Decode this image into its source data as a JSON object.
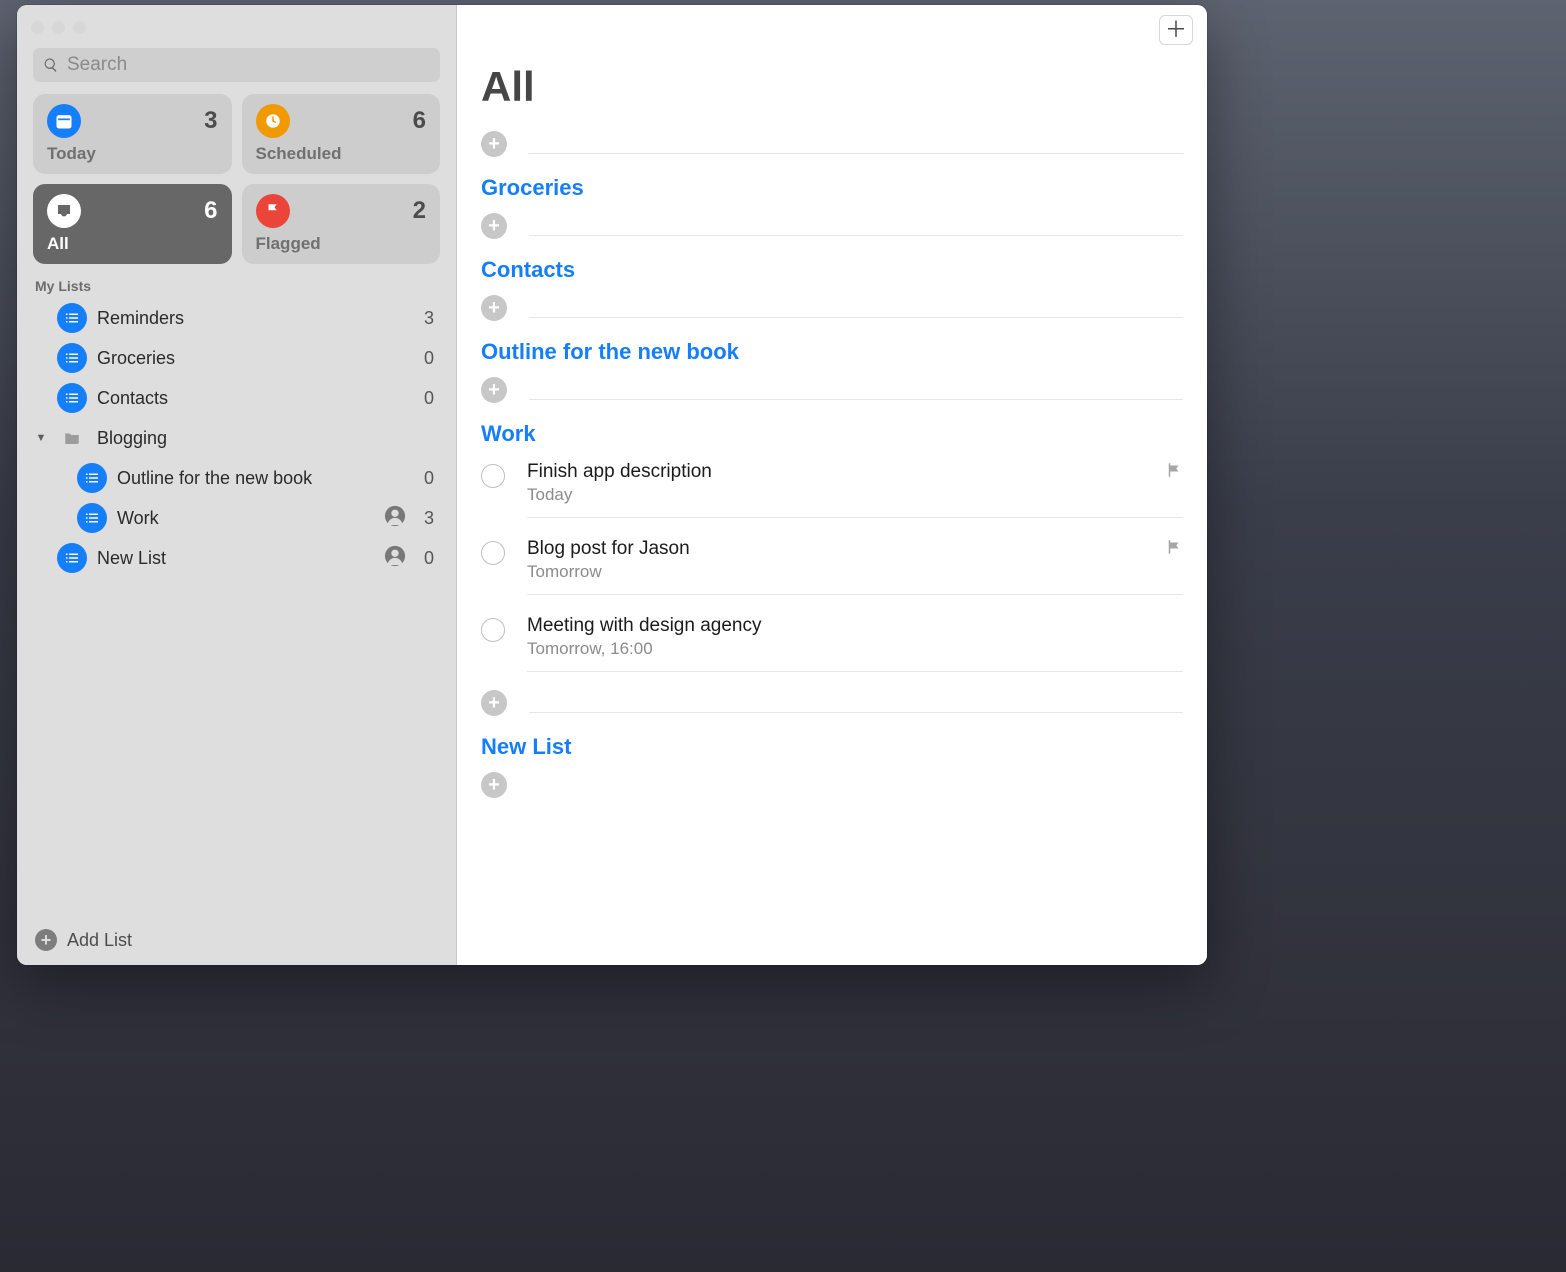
{
  "search_placeholder": "Search",
  "cards": {
    "today": {
      "label": "Today",
      "count": "3"
    },
    "scheduled": {
      "label": "Scheduled",
      "count": "6"
    },
    "all": {
      "label": "All",
      "count": "6"
    },
    "flagged": {
      "label": "Flagged",
      "count": "2"
    }
  },
  "sidebar": {
    "section_label": "My Lists",
    "items": [
      {
        "name": "Reminders",
        "count": "3"
      },
      {
        "name": "Groceries",
        "count": "0"
      },
      {
        "name": "Contacts",
        "count": "0"
      }
    ],
    "folder": {
      "name": "Blogging"
    },
    "children": [
      {
        "name": "Outline for the new book",
        "count": "0"
      },
      {
        "name": "Work",
        "count": "3",
        "shared": true
      }
    ],
    "extra": {
      "name": "New List",
      "count": "0",
      "shared": true
    },
    "add_list_label": "Add List"
  },
  "main": {
    "title": "All",
    "sections": [
      {
        "heading": null
      },
      {
        "heading": "Groceries"
      },
      {
        "heading": "Contacts"
      },
      {
        "heading": "Outline for the new book"
      },
      {
        "heading": "Work",
        "tasks": [
          {
            "title": "Finish app description",
            "sub": "Today",
            "flagged": true
          },
          {
            "title": "Blog post for Jason",
            "sub": "Tomorrow",
            "flagged": true
          },
          {
            "title": "Meeting with design agency",
            "sub": "Tomorrow, 16:00",
            "flagged": false
          }
        ]
      },
      {
        "heading": "New List"
      }
    ]
  }
}
